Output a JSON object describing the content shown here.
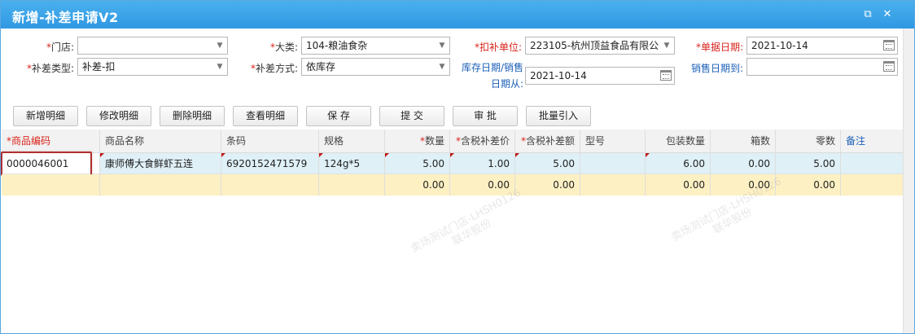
{
  "window": {
    "title": "新增-补差申请V2"
  },
  "form": {
    "store": {
      "label": "门店:",
      "value": ""
    },
    "category": {
      "label": "大类:",
      "value": "104-粮油食杂"
    },
    "deduct_unit": {
      "label": "扣补单位:",
      "value": "223105-杭州顶益食品有限公"
    },
    "doc_date": {
      "label": "单据日期:",
      "value": "2021-10-14"
    },
    "diff_type": {
      "label": "补差类型:",
      "value": "补差-扣"
    },
    "diff_method": {
      "label": "补差方式:",
      "value": "依库存"
    },
    "stock_date_from": {
      "label": "库存日期/销售日期从:",
      "value": "2021-10-14"
    },
    "sales_date_to": {
      "label": "销售日期到:",
      "value": ""
    }
  },
  "toolbar": {
    "add_detail": "新增明细",
    "edit_detail": "修改明细",
    "delete_detail": "删除明细",
    "view_detail": "查看明细",
    "save": "保 存",
    "submit": "提 交",
    "review": "审 批",
    "batch_import": "批量引入"
  },
  "grid": {
    "headers": {
      "code": "商品编码",
      "name": "商品名称",
      "barcode": "条码",
      "spec": "规格",
      "qty": "数量",
      "price": "含税补差价",
      "amount": "含税补差额",
      "model": "型号",
      "pack_qty": "包装数量",
      "boxes": "箱数",
      "pieces": "零数",
      "remark": "备注"
    },
    "rows": [
      {
        "code": "0000046001",
        "name": "康师傅大食鲜虾五连",
        "barcode": "6920152471579",
        "spec": "124g*5",
        "qty": "5.00",
        "price": "1.00",
        "amount": "5.00",
        "model": "",
        "pack_qty": "6.00",
        "boxes": "0.00",
        "pieces": "5.00",
        "remark": ""
      }
    ],
    "totals": {
      "qty": "0.00",
      "price": "0.00",
      "amount": "0.00",
      "pack_qty": "0.00",
      "boxes": "0.00",
      "pieces": "0.00"
    }
  },
  "watermark": {
    "line1": "卖场测试门店-LHSH0126",
    "line2": "联华股份"
  },
  "colors": {
    "titlebar": "#2f98e2",
    "required": "#d9241c",
    "link_label": "#1c5fb8",
    "row_selected": "#dff0f7",
    "row_total": "#fdf0c3",
    "highlight": "#b03030"
  }
}
